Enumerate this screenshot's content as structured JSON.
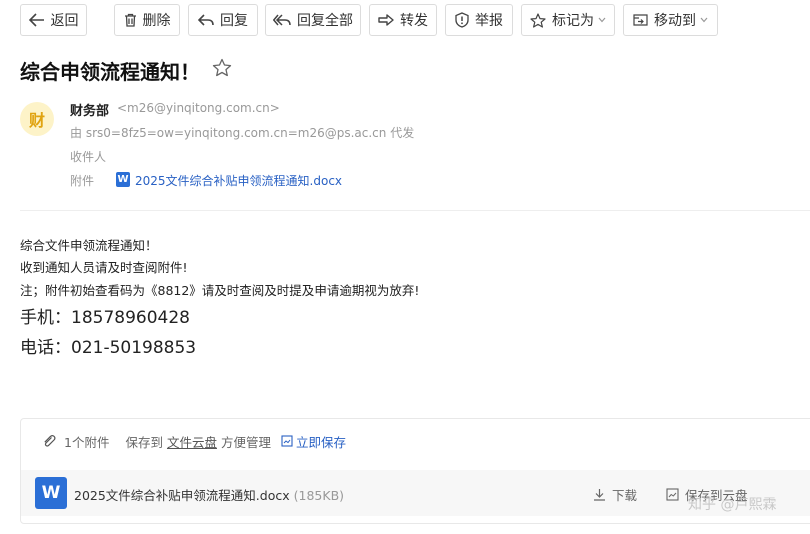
{
  "toolbar": {
    "back": "返回",
    "delete": "删除",
    "reply": "回复",
    "reply_all": "回复全部",
    "forward": "转发",
    "report": "举报",
    "mark_as": "标记为",
    "move_to": "移动到"
  },
  "subject": "综合申领流程通知！",
  "sender": {
    "avatar_char": "财",
    "name": "财务部",
    "email": "<m26@yinqitong.com.cn>",
    "via": "由 srs0=8fz5=ow=yinqitong.com.cn=m26@ps.ac.cn 代发"
  },
  "recipients_label": "收件人",
  "attachment_label": "附件",
  "attachment_filename": "2025文件综合补贴申领流程通知.docx",
  "word_letter": "W",
  "body": {
    "line1": "综合文件申领流程通知！",
    "line2": "收到通知人员请及时查阅附件!",
    "line3": "注；附件初始查看码为《8812》请及时查阅及时提及申请逾期视为放弃!",
    "phone": "手机：18578960428",
    "tel": "电话：021-50198853"
  },
  "attachments_panel": {
    "count": "1个附件",
    "save_to": "保存到",
    "cloud": "文件云盘",
    "manage": "方便管理",
    "save_now": "立即保存",
    "file_name": "2025文件综合补贴申领流程通知.docx",
    "file_size": "(185KB)",
    "download": "下载",
    "save_cloud": "保存到云盘"
  },
  "watermark": "知乎 @卢熙霖",
  "colors": {
    "link": "#2961c4",
    "word_blue": "#2b6fd6",
    "avatar_bg": "#fdf3c8",
    "avatar_fg": "#e0a310"
  }
}
